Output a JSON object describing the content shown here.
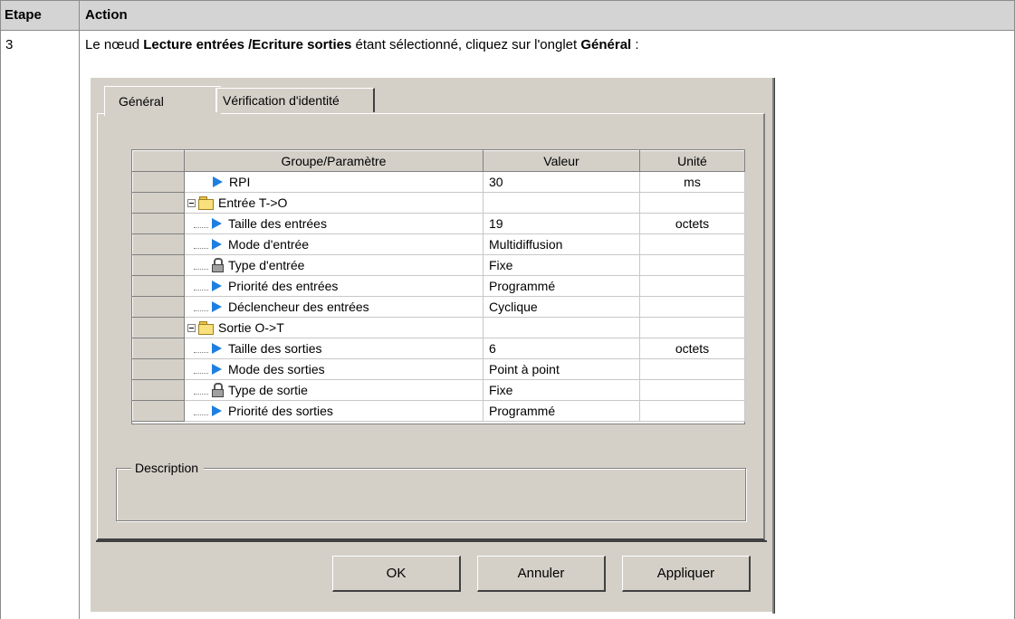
{
  "table": {
    "col_step": "Etape",
    "col_action": "Action",
    "step_number": "3",
    "instruction": {
      "part1": "Le nœud ",
      "bold1": "Lecture entrées /Ecriture sorties",
      "part2": " étant sélectionné, cliquez sur l'onglet ",
      "bold2": "Général",
      "part3": " :"
    }
  },
  "dialog": {
    "tabs": [
      "Général",
      "Vérification d'identité"
    ],
    "active_tab": "Général",
    "grid": {
      "headers": [
        "Groupe/Paramètre",
        "Valeur",
        "Unité"
      ],
      "rows": [
        {
          "param": "RPI",
          "value": "30",
          "unit": "ms",
          "icon": "play-icon",
          "level": 0
        },
        {
          "param": "Entrée T->O",
          "value": "",
          "unit": "",
          "icon": "folder-icon",
          "level": 0,
          "group": true
        },
        {
          "param": "Taille des entrées",
          "value": "19",
          "unit": "octets",
          "icon": "play-icon",
          "level": 1
        },
        {
          "param": "Mode d'entrée",
          "value": "Multidiffusion",
          "unit": "",
          "icon": "play-icon",
          "level": 1
        },
        {
          "param": "Type d'entrée",
          "value": "Fixe",
          "unit": "",
          "icon": "lock-icon",
          "level": 1
        },
        {
          "param": "Priorité des entrées",
          "value": "Programmé",
          "unit": "",
          "icon": "play-icon",
          "level": 1
        },
        {
          "param": "Déclencheur des entrées",
          "value": "Cyclique",
          "unit": "",
          "icon": "play-icon",
          "level": 1
        },
        {
          "param": "Sortie O->T",
          "value": "",
          "unit": "",
          "icon": "folder-icon",
          "level": 0,
          "group": true
        },
        {
          "param": "Taille des sorties",
          "value": "6",
          "unit": "octets",
          "icon": "play-icon",
          "level": 1
        },
        {
          "param": "Mode des sorties",
          "value": "Point à point",
          "unit": "",
          "icon": "play-icon",
          "level": 1
        },
        {
          "param": "Type de sortie",
          "value": "Fixe",
          "unit": "",
          "icon": "lock-icon",
          "level": 1
        },
        {
          "param": "Priorité des sorties",
          "value": "Programmé",
          "unit": "",
          "icon": "play-icon",
          "level": 1
        }
      ]
    },
    "description_label": "Description",
    "buttons": {
      "ok": "OK",
      "cancel": "Annuler",
      "apply": "Appliquer"
    }
  }
}
